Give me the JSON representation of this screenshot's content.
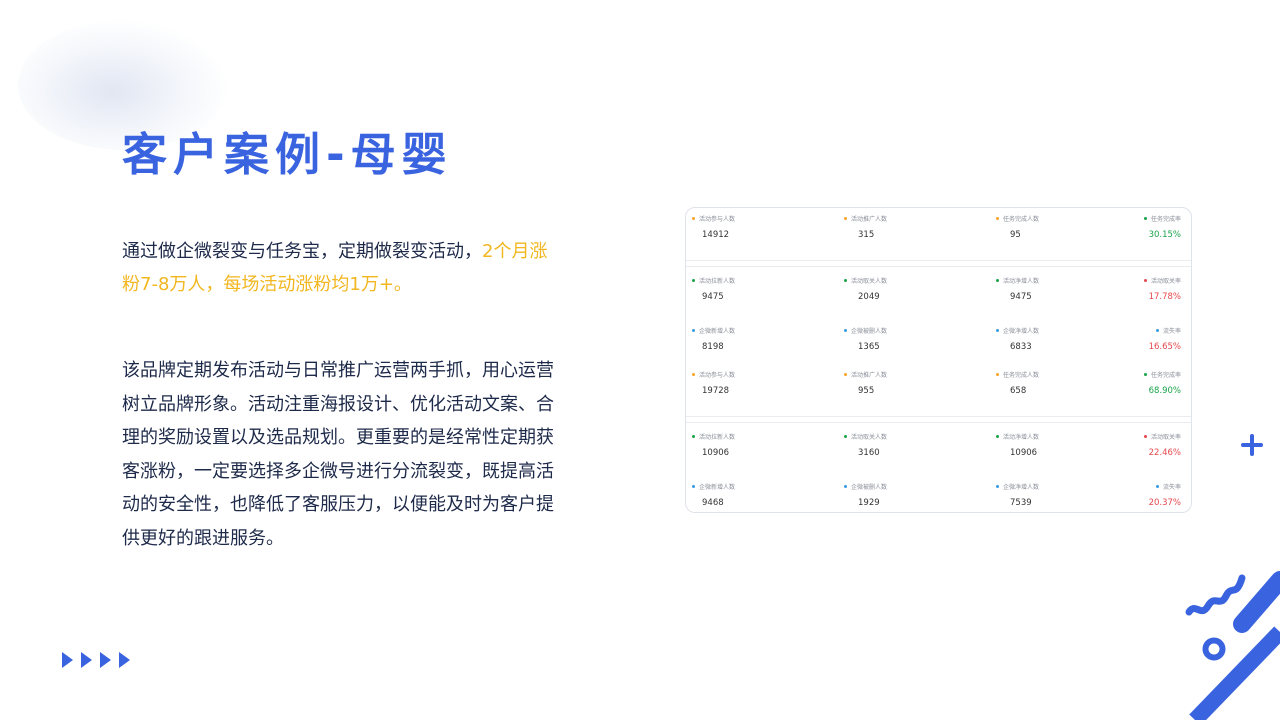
{
  "title": "客户案例-母婴",
  "intro": {
    "part1": "通过做企微裂变与任务宝，定期做裂变活动，",
    "highlight": "2个月涨粉7-8万人，每场活动涨粉均1万+。"
  },
  "body_text": "该品牌定期发布活动与日常推广运营两手抓，用心运营树立品牌形象。活动注重海报设计、优化活动文案、合理的奖励设置以及选品规划。更重要的是经常性定期获客涨粉，一定要选择多企微号进行分流裂变，既提高活动的安全性，也降低了客服压力，以便能及时为客户提供更好的跟进服务。",
  "colors": {
    "accent": "#3a63e0",
    "highlight": "#f2b61f",
    "text": "#1e2a4a",
    "stat_red": "#e5484d",
    "stat_green": "#1aa34a"
  },
  "stats_card": {
    "sections": [
      {
        "rows": [
          [
            {
              "label": "活动参与人数",
              "value": "14912",
              "dot": "#f5a623"
            },
            {
              "label": "活动推广人数",
              "value": "315",
              "dot": "#f5a623"
            },
            {
              "label": "任务完成人数",
              "value": "95",
              "dot": "#f5a623"
            },
            {
              "label": "任务完成率",
              "value": "30.15%",
              "dot": "#1aa34a",
              "value_color": "#1aa34a"
            }
          ]
        ]
      },
      {
        "rows": [
          [
            {
              "label": "活动拉新人数",
              "value": "9475",
              "dot": "#1aa34a"
            },
            {
              "label": "活动取关人数",
              "value": "2049",
              "dot": "#1aa34a"
            },
            {
              "label": "活动净增人数",
              "value": "9475",
              "dot": "#1aa34a"
            },
            {
              "label": "活动取关率",
              "value": "17.78%",
              "dot": "#e5484d",
              "value_color": "#e5484d"
            }
          ],
          [
            {
              "label": "企微新增人数",
              "value": "8198",
              "dot": "#3a9be0"
            },
            {
              "label": "企微被删人数",
              "value": "1365",
              "dot": "#3a9be0"
            },
            {
              "label": "企微净增人数",
              "value": "6833",
              "dot": "#3a9be0"
            },
            {
              "label": "流失率",
              "value": "16.65%",
              "dot": "#3a9be0",
              "value_color": "#e5484d"
            }
          ],
          [
            {
              "label": "活动参与人数",
              "value": "19728",
              "dot": "#f5a623"
            },
            {
              "label": "活动推广人数",
              "value": "955",
              "dot": "#f5a623"
            },
            {
              "label": "任务完成人数",
              "value": "658",
              "dot": "#f5a623"
            },
            {
              "label": "任务完成率",
              "value": "68.90%",
              "dot": "#1aa34a",
              "value_color": "#1aa34a"
            }
          ]
        ]
      },
      {
        "rows": [
          [
            {
              "label": "活动拉新人数",
              "value": "10906",
              "dot": "#1aa34a"
            },
            {
              "label": "活动取关人数",
              "value": "3160",
              "dot": "#1aa34a"
            },
            {
              "label": "活动净增人数",
              "value": "10906",
              "dot": "#1aa34a"
            },
            {
              "label": "活动取关率",
              "value": "22.46%",
              "dot": "#e5484d",
              "value_color": "#e5484d"
            }
          ],
          [
            {
              "label": "企微新增人数",
              "value": "9468",
              "dot": "#3a9be0"
            },
            {
              "label": "企微被删人数",
              "value": "1929",
              "dot": "#3a9be0"
            },
            {
              "label": "企微净增人数",
              "value": "7539",
              "dot": "#3a9be0"
            },
            {
              "label": "流失率",
              "value": "20.37%",
              "dot": "#3a9be0",
              "value_color": "#e5484d"
            }
          ]
        ]
      }
    ]
  },
  "icons": [
    "blur-blob",
    "arrow-right-icon",
    "plus-icon",
    "squiggle-icon",
    "ring-icon",
    "stripe-decoration"
  ]
}
